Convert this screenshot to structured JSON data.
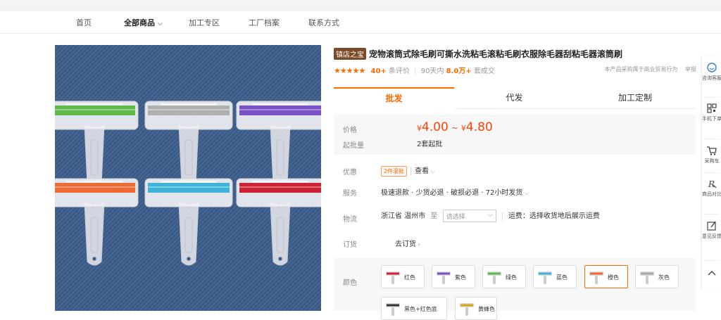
{
  "nav": {
    "items": [
      "首页",
      "全部商品",
      "加工专区",
      "工厂档案",
      "联系方式"
    ],
    "active_index": 1,
    "chevron": "⌵"
  },
  "product": {
    "shop_badge": "镇店之宝",
    "title": "宠物滚筒式除毛刷可撕水洗粘毛滚粘毛刷衣服除毛器刮粘毛器滚筒刷",
    "rating": {
      "stars": "★★★★★",
      "review_count": "40+",
      "review_label": "条评价",
      "sales_prefix": "90天内",
      "sales_count": "8.0万+",
      "sales_suffix": "套成交",
      "note": "本产品采购属于商业贸易行为",
      "note_tail": "举报"
    },
    "image_description": "product-photo-six-rollers"
  },
  "tabs": [
    {
      "label": "批发"
    },
    {
      "label": "代发"
    },
    {
      "label": "加工定制"
    }
  ],
  "pricing": {
    "price_label": "价格",
    "currency": "¥",
    "price_min": "4.00",
    "range_sep": "~",
    "price_max": "4.80",
    "moq_label": "起批量",
    "moq_value": "2套起批"
  },
  "details": {
    "promo_label": "优惠",
    "promo_tag": "2件混批",
    "promo_view": "查看",
    "service_label": "服务",
    "service_value": "极速退款 · 少货必退 · 破损必退 · 72小时发货",
    "logistics_label": "物流",
    "origin": "浙江省 温州市",
    "to_label": "至",
    "destination_placeholder": "请选择",
    "shipping": "运费：选择收货地后展示运费",
    "order_label": "订货",
    "order_link": "去订货"
  },
  "colors": {
    "label": "颜色",
    "options": [
      {
        "name": "红色",
        "hex": "#cc2233"
      },
      {
        "name": "紫色",
        "hex": "#7a52c8"
      },
      {
        "name": "绿色",
        "hex": "#5dba4a"
      },
      {
        "name": "蓝色",
        "hex": "#3fb4d9"
      },
      {
        "name": "橙色",
        "hex": "#f06a35"
      },
      {
        "name": "灰色",
        "hex": "#a8a8a8"
      },
      {
        "name": "黑色+红色底",
        "hex": "#333333"
      },
      {
        "name": "黄蜂色",
        "hex": "#d9a21b"
      }
    ],
    "selected_index": 4
  },
  "sidebar": [
    {
      "icon": "headset-icon",
      "label": "咨询客服"
    },
    {
      "icon": "qrcode-icon",
      "label": "手机下单"
    },
    {
      "icon": "cart-icon",
      "label": "采购车"
    },
    {
      "icon": "compare-icon",
      "label": "商品对比"
    },
    {
      "icon": "feedback-icon",
      "label": "意见反馈"
    },
    {
      "icon": "back-to-top-icon",
      "label": ""
    }
  ],
  "theme": {
    "accent": "#ff6a00",
    "price_color": "#ff4400",
    "badge_bg": "#7b4a26"
  }
}
